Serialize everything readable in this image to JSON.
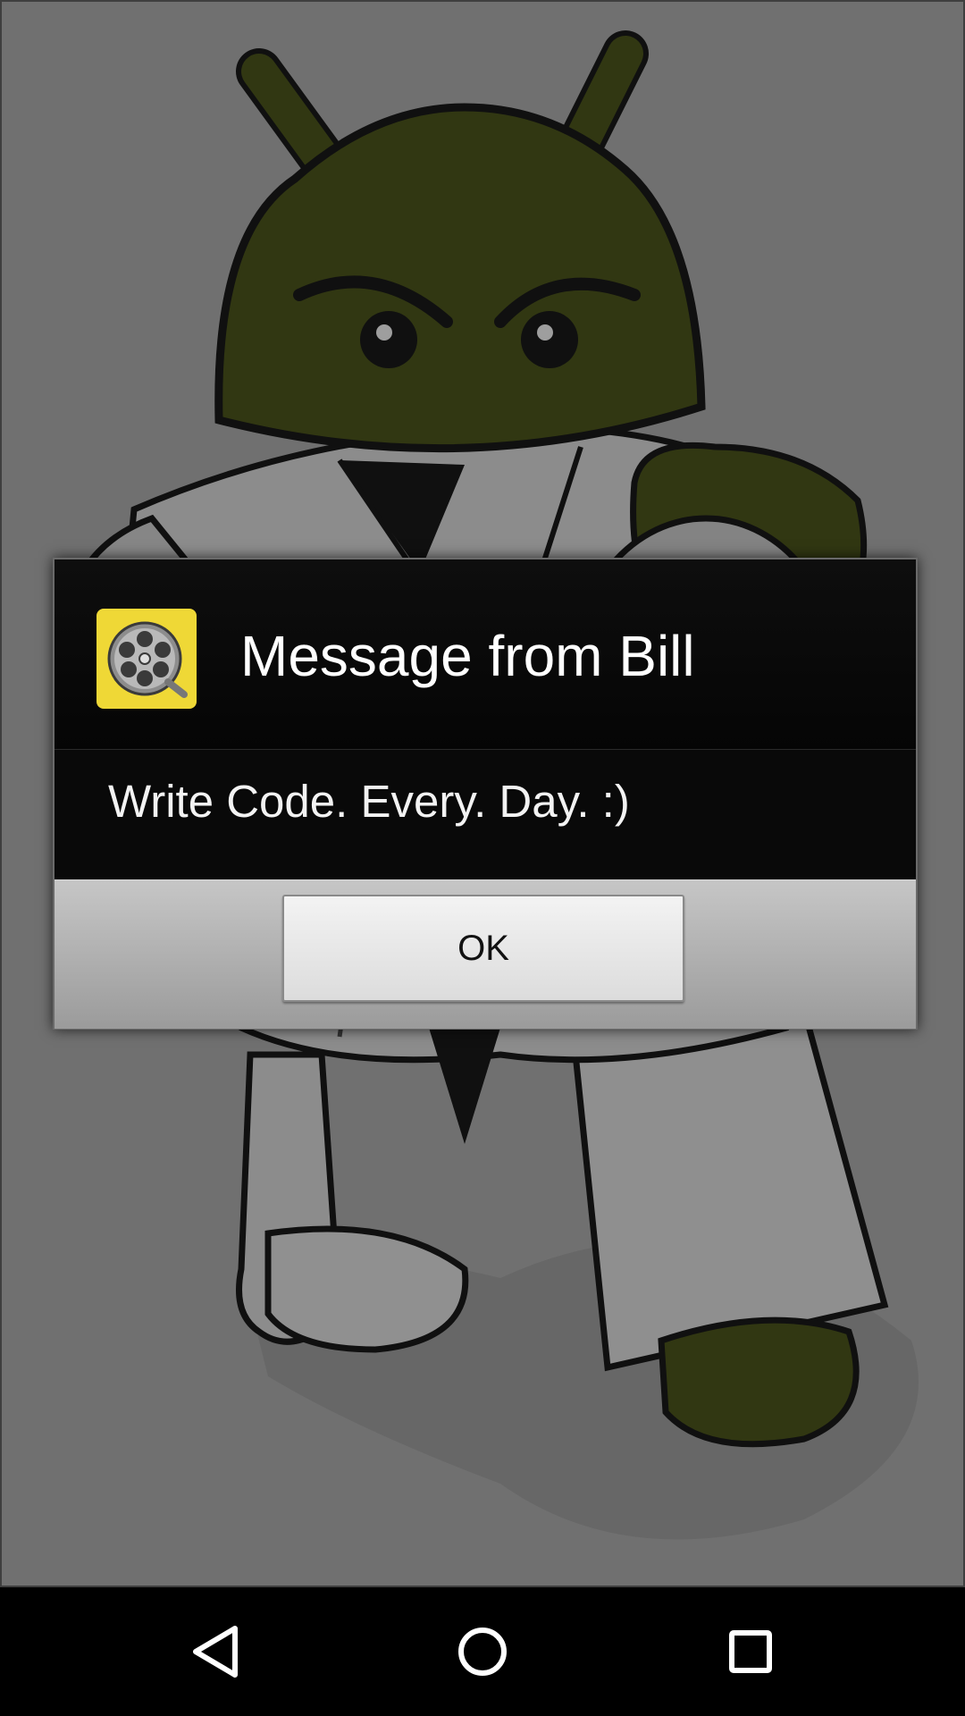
{
  "dialog": {
    "title": "Message from Bill",
    "message": "Write Code. Every. Day. :)",
    "ok_label": "OK",
    "icon": "film-reel-icon"
  },
  "colors": {
    "android_green": "#4f591d",
    "dialog_background": "#090909",
    "button_bar": "#a8a8a8",
    "icon_background": "#efd836"
  },
  "navigation": {
    "back_icon": "back-triangle-icon",
    "home_icon": "home-circle-icon",
    "recents_icon": "recents-square-icon"
  }
}
